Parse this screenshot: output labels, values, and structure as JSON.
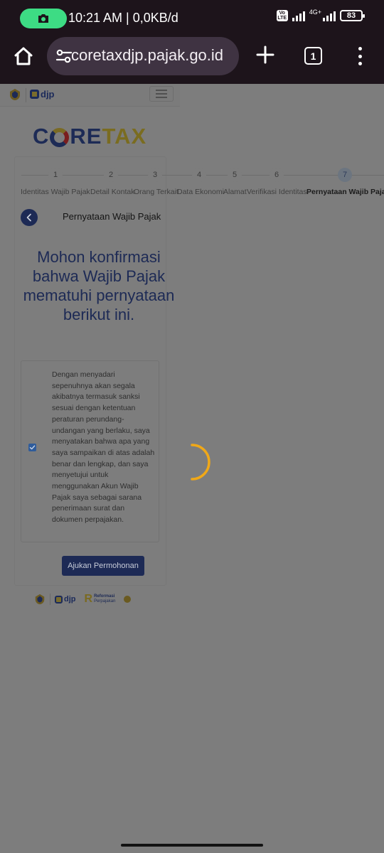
{
  "status_bar": {
    "time_and_speed": "10:21 AM | 0,0KB/d",
    "volte_label": "Vo LTE",
    "network_label": "4G+",
    "battery_level": "83",
    "screen_record_icon": "camera-icon"
  },
  "browser": {
    "home_icon": "home-icon",
    "site_settings_icon": "tune-icon",
    "url": "coretaxdjp.pajak.go.id",
    "new_tab_icon": "plus-icon",
    "tab_count": "1",
    "menu_icon": "more-vertical-icon"
  },
  "site_header": {
    "emblem_icon": "kemenkeu-emblem-icon",
    "brand": "djp",
    "menu_icon": "hamburger-icon"
  },
  "logo": {
    "part1": "C",
    "part2": "RE",
    "part3": "TAX"
  },
  "stepper": {
    "steps": [
      {
        "number": "1",
        "label": "Identitas Wajib Pajak"
      },
      {
        "number": "2",
        "label": "Detail Kontak"
      },
      {
        "number": "3",
        "label": "Orang Terkait"
      },
      {
        "number": "4",
        "label": "Data Ekonomi"
      },
      {
        "number": "5",
        "label": "Alamat"
      },
      {
        "number": "6",
        "label": "Verifikasi Identitas"
      },
      {
        "number": "7",
        "label": "Pernyataan Wajib Pajak"
      }
    ],
    "active_step": 7
  },
  "section": {
    "back_icon": "chevron-left-icon",
    "title": "Pernyataan Wajib Pajak",
    "heading": "Mohon konfirmasi bahwa Wajib Pajak mematuhi pernyataan berikut ini."
  },
  "statement": {
    "checked": true,
    "text": "Dengan menyadari sepenuhnya akan segala akibatnya termasuk sanksi sesuai dengan ketentuan peraturan perundang-undangan yang berlaku, saya menyatakan bahwa apa yang saya sampaikan di atas adalah benar dan lengkap, dan saya menyetujui untuk menggunakan Akun Wajib Pajak saya sebagai sarana penerimaan surat dan dokumen perpajakan."
  },
  "submit_label": "Ajukan Permohonan",
  "footer": {
    "brand": "djp",
    "reform_line1": "Reformasi",
    "reform_line2": "Perpajakan"
  },
  "colors": {
    "overlay_gray": "#7d7d7d",
    "navy": "#1d2a55",
    "spinner": "#f0a818",
    "status_bar": "#1d141b",
    "url_pill": "#3f3342",
    "record_pill": "#3ddc84"
  }
}
